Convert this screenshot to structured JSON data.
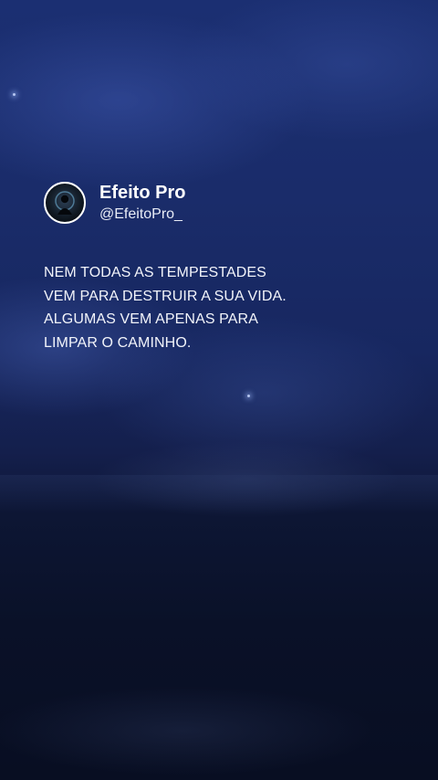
{
  "post": {
    "display_name": "Efeito Pro",
    "handle": "@EfeitoPro_",
    "avatar_icon": "person-silhouette-icon",
    "text_lines": [
      "NEM TODAS AS TEMPESTADES",
      "VEM PARA DESTRUIR A SUA VIDA.",
      "ALGUMAS VEM APENAS PARA",
      "LIMPAR O CAMINHO."
    ]
  },
  "colors": {
    "sky_top": "#1b2f72",
    "sea_bottom": "#080e22",
    "text": "#ffffff"
  }
}
